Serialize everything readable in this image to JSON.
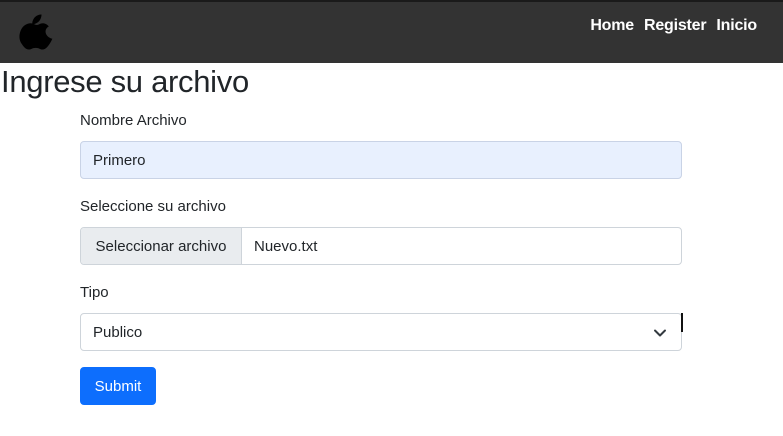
{
  "navbar": {
    "logo_icon": "apple-logo-icon",
    "links": [
      "Home",
      "Register",
      "Inicio"
    ]
  },
  "page": {
    "title": "Ingrese su archivo"
  },
  "form": {
    "name_label": "Nombre Archivo",
    "name_value": "Primero",
    "file_label": "Seleccione su archivo",
    "file_button": "Seleccionar archivo",
    "file_name": "Nuevo.txt",
    "type_label": "Tipo",
    "type_selected": "Publico",
    "submit_label": "Submit"
  },
  "colors": {
    "navbar_bg": "#333333",
    "autofill_bg": "#e8f0fe",
    "primary": "#0d6efd"
  }
}
